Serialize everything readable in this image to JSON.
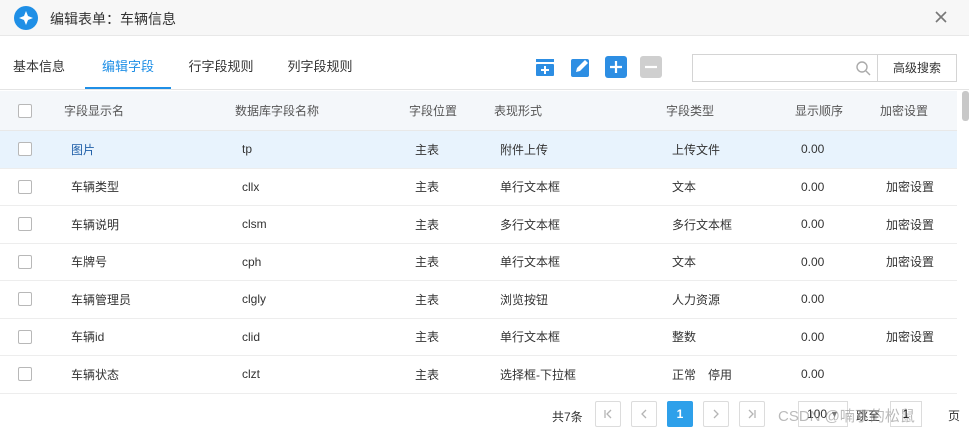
{
  "window": {
    "title": "编辑表单：车辆信息"
  },
  "tabs": [
    {
      "label": "基本信息"
    },
    {
      "label": "编辑字段"
    },
    {
      "label": "行字段规则"
    },
    {
      "label": "列字段规则"
    }
  ],
  "toolbar": {
    "search_value": "",
    "advanced_search_label": "高级搜索"
  },
  "table": {
    "headers": [
      "字段显示名",
      "数据库字段名称",
      "字段位置",
      "表现形式",
      "字段类型",
      "显示顺序",
      "加密设置"
    ],
    "rows": [
      {
        "name": "图片",
        "db": "tp",
        "position": "主表",
        "form": "附件上传",
        "type": "上传文件",
        "order": "0.00",
        "encrypt": ""
      },
      {
        "name": "车辆类型",
        "db": "cllx",
        "position": "主表",
        "form": "单行文本框",
        "type": "文本",
        "order": "0.00",
        "encrypt": "加密设置"
      },
      {
        "name": "车辆说明",
        "db": "clsm",
        "position": "主表",
        "form": "多行文本框",
        "type": "多行文本框",
        "order": "0.00",
        "encrypt": "加密设置"
      },
      {
        "name": "车牌号",
        "db": "cph",
        "position": "主表",
        "form": "单行文本框",
        "type": "文本",
        "order": "0.00",
        "encrypt": "加密设置"
      },
      {
        "name": "车辆管理员",
        "db": "clgly",
        "position": "主表",
        "form": "浏览按钮",
        "type": "人力资源",
        "order": "0.00",
        "encrypt": ""
      },
      {
        "name": "车辆id",
        "db": "clid",
        "position": "主表",
        "form": "单行文本框",
        "type": "整数",
        "order": "0.00",
        "encrypt": "加密设置"
      },
      {
        "name": "车辆状态",
        "db": "clzt",
        "position": "主表",
        "form": "选择框-下拉框",
        "type": "正常　停用",
        "order": "0.00",
        "encrypt": ""
      }
    ]
  },
  "pagination": {
    "total_label": "共7条",
    "current_page": "1",
    "page_size": "100",
    "goto_label": "跳至",
    "goto_value": "1",
    "page_suffix": "页"
  },
  "watermark": "CSDN @喃丁的松鼠",
  "colors": {
    "accent": "#1f8fe6",
    "selected_row": "#e8f3fd",
    "header_bg": "#f4f7fa"
  }
}
